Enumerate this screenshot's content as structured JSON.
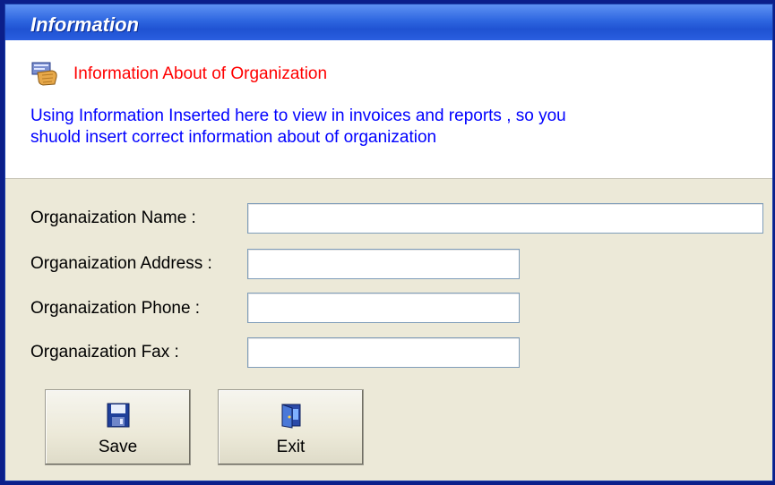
{
  "window": {
    "title": "Information"
  },
  "header": {
    "icon": "hand-card-icon",
    "title": "Information About of  Organization",
    "description_line1": "Using Information Inserted here to view in invoices and reports , so you",
    "description_line2": "shuold insert correct information about of organization"
  },
  "form": {
    "name_label": "Organaization Name :",
    "name_value": "",
    "address_label": "Organaization Address :",
    "address_value": "",
    "phone_label": "Organaization Phone :",
    "phone_value": "",
    "fax_label": "Organaization Fax :",
    "fax_value": ""
  },
  "buttons": {
    "save_label": "Save",
    "save_icon": "floppy-disk-icon",
    "exit_label": "Exit",
    "exit_icon": "exit-door-icon"
  },
  "colors": {
    "title_bar": "#2e66e0",
    "header_title": "#ff0000",
    "header_description": "#0000ff",
    "form_background": "#ece9d8"
  }
}
